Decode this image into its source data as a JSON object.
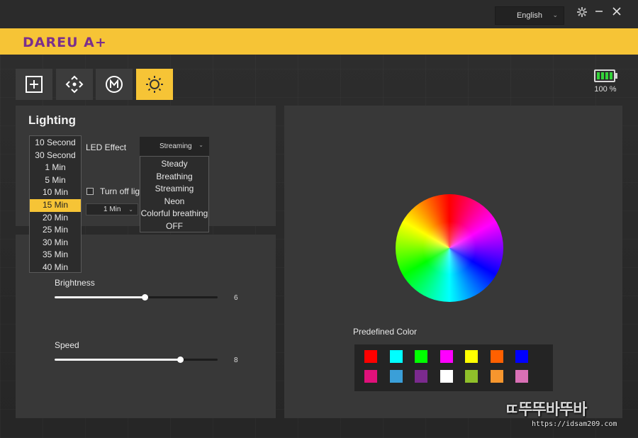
{
  "window": {
    "language": "English",
    "icons": {
      "settings": "gear-icon",
      "minimize": "minimize-icon",
      "close": "close-icon"
    }
  },
  "brand": {
    "logo": "DAREU A+",
    "bar_color": "#f6c436"
  },
  "toolbar": {
    "buttons": [
      {
        "name": "add-macro",
        "icon": "plus-box-icon",
        "active": false
      },
      {
        "name": "button-assign",
        "icon": "dpad-icon",
        "active": false
      },
      {
        "name": "macro",
        "icon": "m-circle-icon",
        "active": false
      },
      {
        "name": "lighting",
        "icon": "sun-icon",
        "active": true
      }
    ]
  },
  "battery": {
    "level_percent": 100,
    "text": "100 %"
  },
  "lighting": {
    "title": "Lighting",
    "led_effect_label": "LED Effect",
    "led_effect_value": "Streaming",
    "effect_options": [
      "Steady",
      "Breathing",
      "Streaming",
      "Neon",
      "Colorful breathing",
      "OFF"
    ],
    "turn_off_label": "Turn off ligh",
    "turn_off_checked": false,
    "time_value": "1 Min",
    "time_options": [
      "10 Second",
      "30 Second",
      "1 Min",
      "5 Min",
      "10 Min",
      "15 Min",
      "20 Min",
      "25 Min",
      "30 Min",
      "35 Min",
      "40 Min"
    ],
    "time_highlighted": "15 Min"
  },
  "sliders": {
    "brightness": {
      "label": "Brightness",
      "value": "6",
      "fraction": 0.55
    },
    "speed": {
      "label": "Speed",
      "value": "8",
      "fraction": 0.77
    }
  },
  "color": {
    "predefined_label": "Predefined Color",
    "swatches": [
      "#ff0000",
      "#00ffff",
      "#00ff00",
      "#ff00ff",
      "#ffff00",
      "#ff6000",
      "#0000ff",
      "#e0117a",
      "#3a9fd8",
      "#7b2a8e",
      "#ffffff",
      "#8fbf2a",
      "#f6962e",
      "#d970b5"
    ]
  },
  "watermark": {
    "text": "ㄸ뚜뚜바뚜바",
    "url": "https://idsam209.com"
  }
}
